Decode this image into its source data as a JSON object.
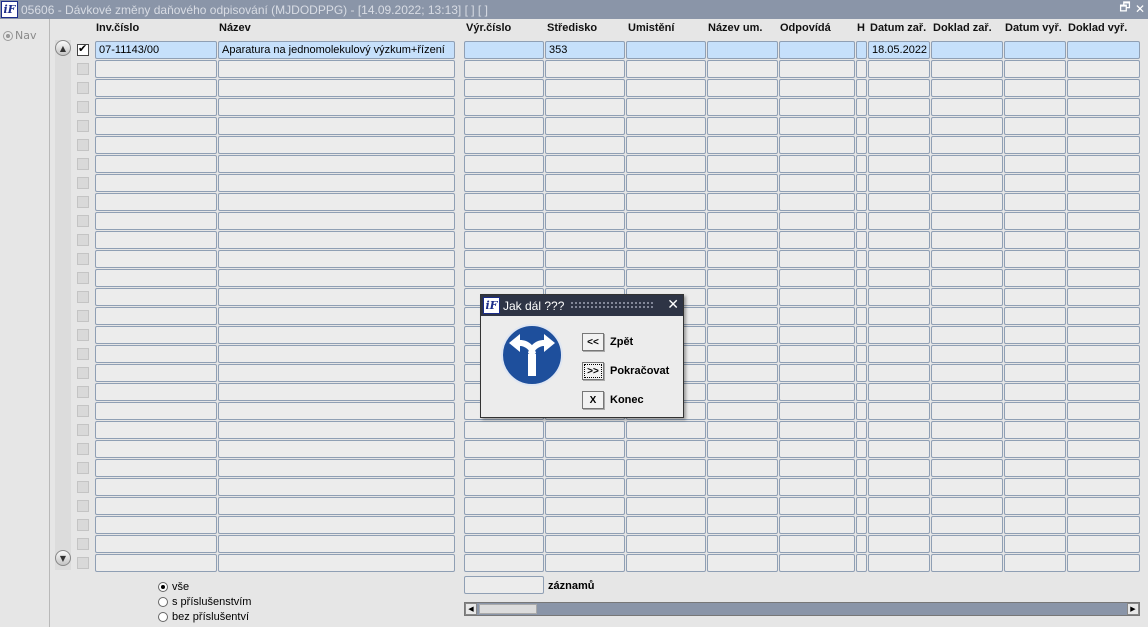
{
  "window": {
    "title": "05606 - Dávkové změny daňového odpisování (MJDODPPG) - [14.09.2022; 13:13]  [ ]  [ ]",
    "logo_text": "iF",
    "restore_icon": "restore-icon",
    "close_icon": "close-icon"
  },
  "nav": {
    "label": "Nav"
  },
  "table": {
    "columns": [
      "Inv.číslo",
      "Název",
      "Výr.číslo",
      "Středisko",
      "Umistění",
      "Název um.",
      "Odpovídá",
      "H",
      "Datum zař.",
      "Doklad zař.",
      "Datum vyř.",
      "Doklad vyř."
    ],
    "rows": [
      [
        "07-11143/00",
        "Aparatura na jednomolekulový výzkum+řízení",
        "",
        "353",
        "",
        "",
        "",
        "",
        "18.05.2022",
        "",
        "",
        ""
      ]
    ],
    "selected_row_checked": true,
    "empty_rows": 27
  },
  "filter": {
    "options": [
      "vše",
      "s příslušenstvím",
      "bez příslušentví"
    ],
    "selected": "vše"
  },
  "footer": {
    "count_value": "",
    "count_label": "záznamů"
  },
  "dialog": {
    "title": "Jak dál ???",
    "logo_text": "iF",
    "buttons": [
      {
        "key": "<<",
        "label": "Zpět"
      },
      {
        "key": ">>",
        "label": "Pokračovat"
      },
      {
        "key": "X",
        "label": "Konec"
      }
    ],
    "focused_button": ">>",
    "sign_icon": "split-arrows-icon",
    "close_glyph": "✕"
  },
  "colors": {
    "selection": "#c6e0fb",
    "titlebar": "#8a95a8",
    "dialog_titlebar": "#2e3445",
    "sign": "#1e4f9c"
  }
}
